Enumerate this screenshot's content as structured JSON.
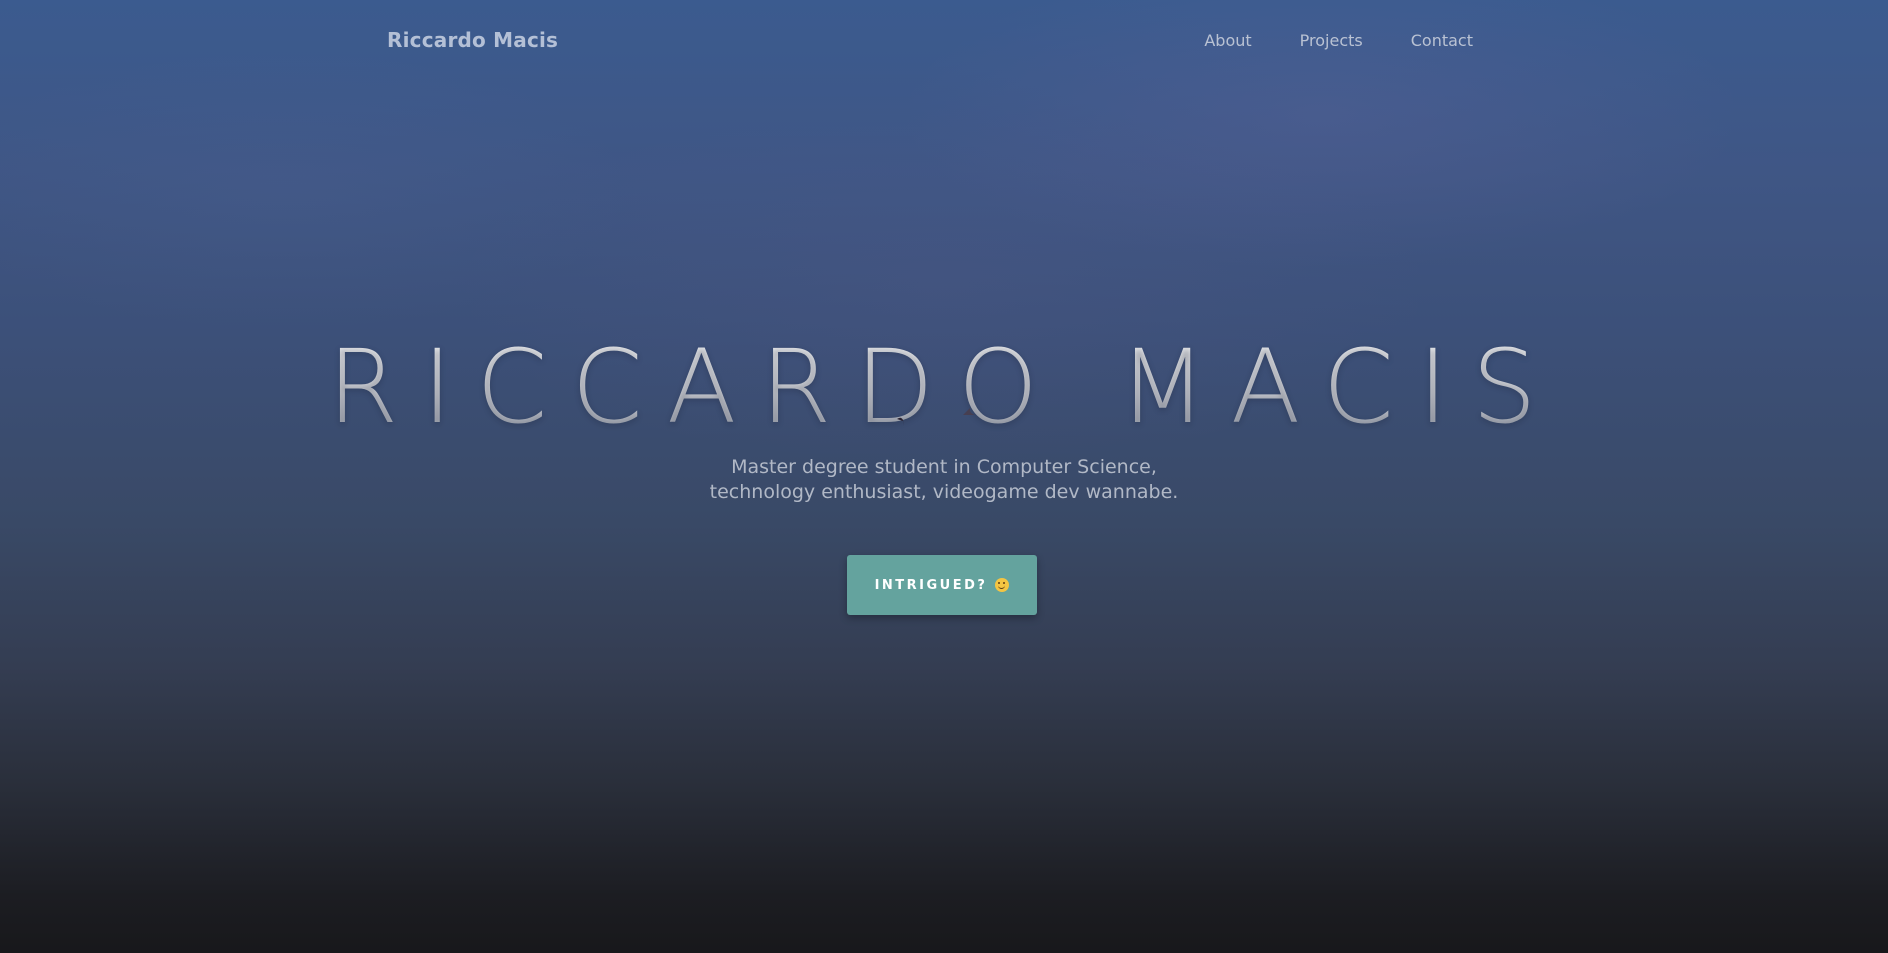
{
  "navbar": {
    "brand": "Riccardo Macis",
    "links": [
      {
        "label": "About"
      },
      {
        "label": "Projects"
      },
      {
        "label": "Contact"
      }
    ]
  },
  "hero": {
    "title": "RICCARDO MACIS",
    "subtitle_line1": "Master degree student in Computer Science,",
    "subtitle_line2": "technology enthusiast, videogame dev wannabe.",
    "cta_label": "INTRIGUED?",
    "cta_icon": "smirk-emoji-icon"
  },
  "colors": {
    "accent": "#64a39e",
    "background_top": "#3b5b8f",
    "background_bottom": "#18181b"
  }
}
